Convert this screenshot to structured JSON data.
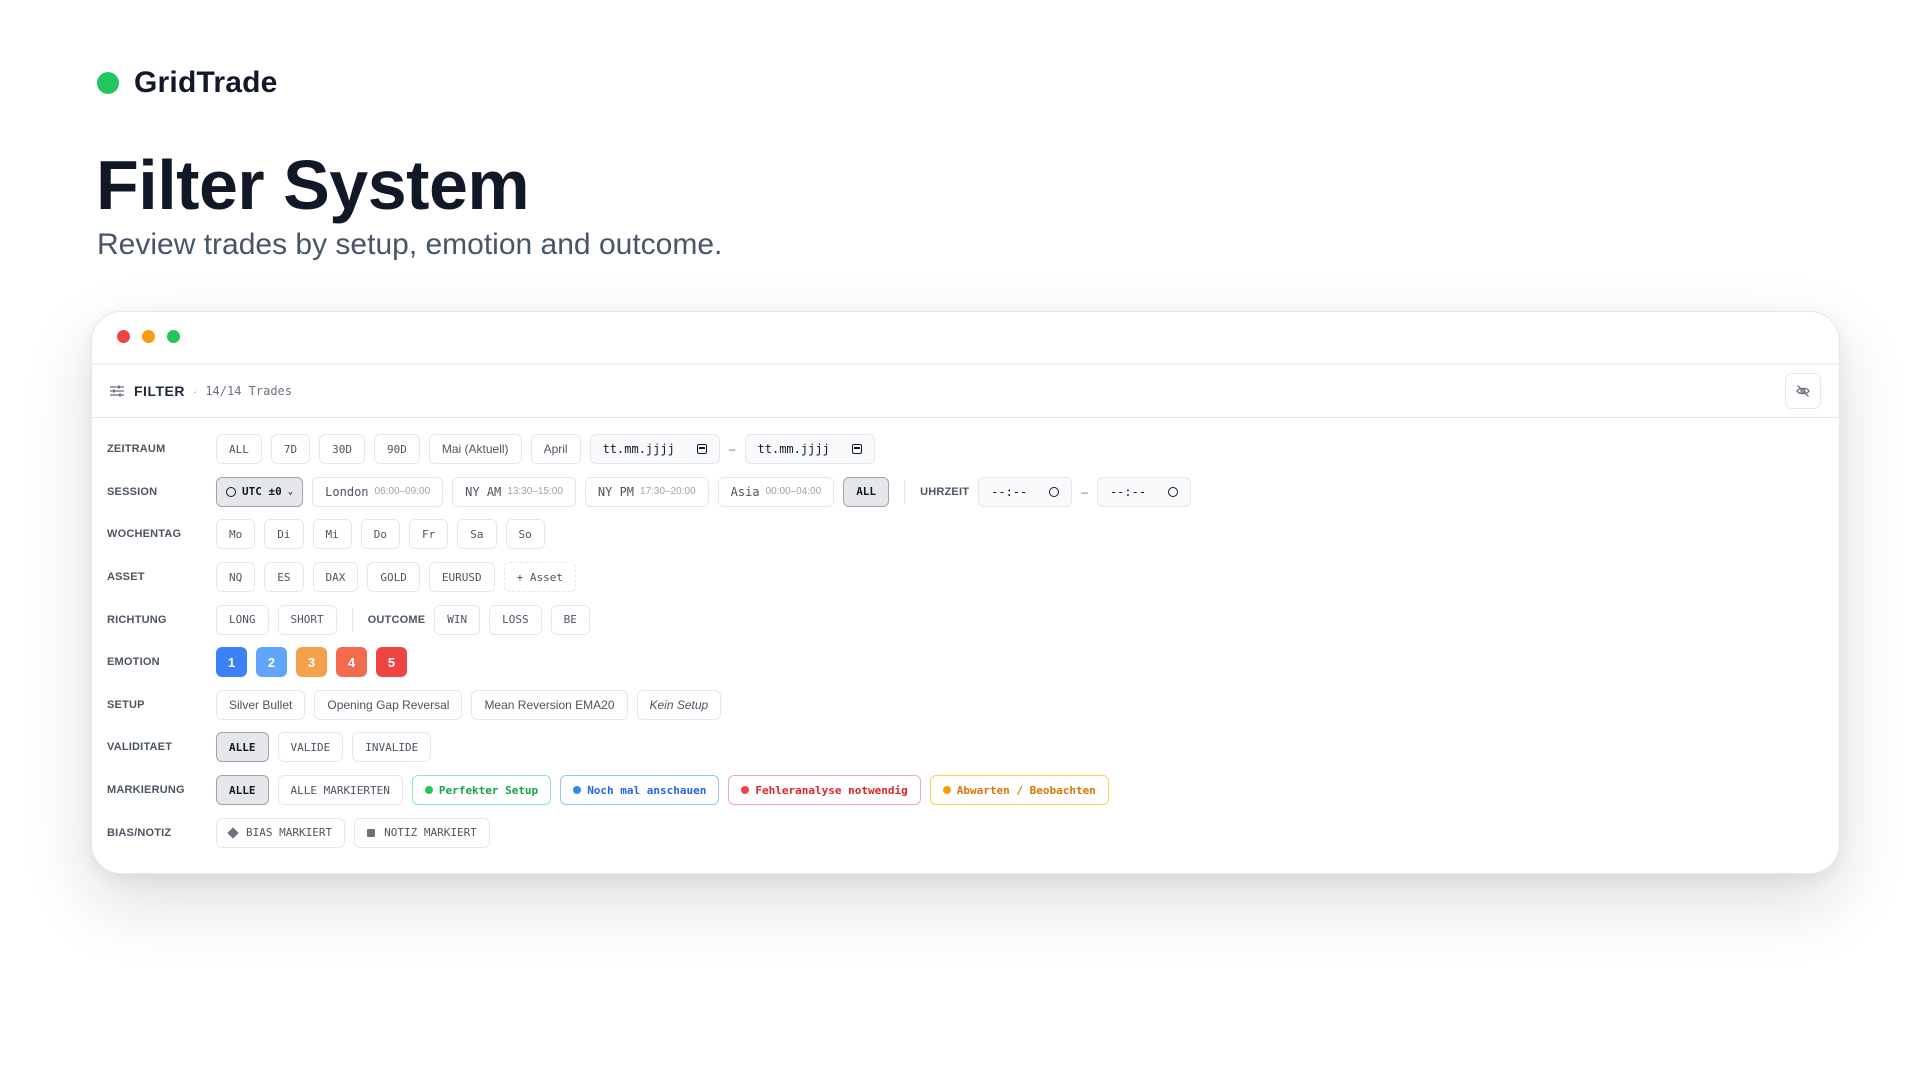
{
  "brand": {
    "name": "GridTrade",
    "dot_color": "#22c55e"
  },
  "hero": {
    "title": "Filter System",
    "subtitle": "Review trades by setup, emotion and outcome."
  },
  "panel": {
    "title": "FILTER",
    "separator": "·",
    "trade_count": "14/14 Trades",
    "hide_icon": "eye-off-icon"
  },
  "zeitraum": {
    "label": "ZEITRAUM",
    "options": [
      "ALL",
      "7D",
      "30D",
      "90D",
      "Mai (Aktuell)",
      "April"
    ],
    "date_from_placeholder": "tt.mm.jjjj",
    "date_to_placeholder": "tt.mm.jjjj",
    "range_dash": "–"
  },
  "session": {
    "label": "SESSION",
    "timezone": "UTC ±0",
    "sessions": [
      {
        "name": "London",
        "time": "06:00–09:00"
      },
      {
        "name": "NY AM",
        "time": "13:30–15:00"
      },
      {
        "name": "NY PM",
        "time": "17:30–20:00"
      },
      {
        "name": "Asia",
        "time": "00:00–04:00"
      }
    ],
    "all_label": "ALL",
    "time_label": "UHRZEIT",
    "time_from": "--:--",
    "time_to": "--:--",
    "range_dash": "–"
  },
  "wochentag": {
    "label": "WOCHENTAG",
    "days": [
      "Mo",
      "Di",
      "Mi",
      "Do",
      "Fr",
      "Sa",
      "So"
    ]
  },
  "asset": {
    "label": "ASSET",
    "assets": [
      "NQ",
      "ES",
      "DAX",
      "GOLD",
      "EURUSD"
    ],
    "add_label": "+ Asset"
  },
  "richtung": {
    "label": "RICHTUNG",
    "options": [
      "LONG",
      "SHORT"
    ]
  },
  "outcome": {
    "label": "OUTCOME",
    "options": [
      "WIN",
      "LOSS",
      "BE"
    ]
  },
  "emotion": {
    "label": "EMOTION",
    "levels": [
      {
        "value": "1",
        "color": "#3b82f6"
      },
      {
        "value": "2",
        "color": "#60a5fa"
      },
      {
        "value": "3",
        "color": "#f5a04b"
      },
      {
        "value": "4",
        "color": "#f26b4f"
      },
      {
        "value": "5",
        "color": "#ef4444"
      }
    ]
  },
  "setup": {
    "label": "SETUP",
    "options": [
      "Silver Bullet",
      "Opening Gap Reversal",
      "Mean Reversion EMA20"
    ],
    "none_label": "Kein Setup"
  },
  "validitaet": {
    "label": "VALIDITAET",
    "options": [
      "ALLE",
      "VALIDE",
      "INVALIDE"
    ],
    "active": "ALLE"
  },
  "markierung": {
    "label": "MARKIERUNG",
    "plain": [
      "ALLE",
      "ALLE MARKIERTEN"
    ],
    "active": "ALLE",
    "tags": [
      {
        "label": "Perfekter Setup",
        "color": "#16a34a",
        "border": "#86efac"
      },
      {
        "label": "Noch mal anschauen",
        "color": "#2563eb",
        "border": "#93c5fd"
      },
      {
        "label": "Fehleranalyse notwendig",
        "color": "#dc2626",
        "border": "#fca5a5"
      },
      {
        "label": "Abwarten / Beobachten",
        "color": "#d97706",
        "border": "#fcd34d"
      }
    ]
  },
  "bias": {
    "label": "BIAS/NOTIZ",
    "options": [
      "BIAS MARKIERT",
      "NOTIZ MARKIERT"
    ]
  }
}
